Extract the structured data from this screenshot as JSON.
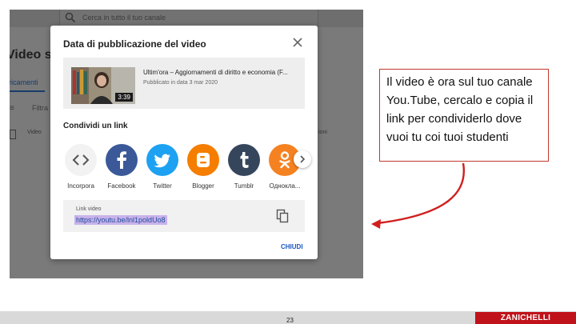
{
  "background": {
    "search_placeholder": "Cerca in tutto il tuo canale",
    "page_title": "Video su",
    "tab_label": "aricamenti",
    "filter_label": "Filtra",
    "column_video": "Video",
    "column_right": "ioni"
  },
  "modal": {
    "title": "Data di pubblicazione del video",
    "video": {
      "title": "Ultim'ora – Aggiornamenti di diritto e economia (F...",
      "published": "Pubblicato in data 3 mar 2020",
      "duration": "3:39"
    },
    "share_title": "Condividi un link",
    "share_options": [
      {
        "label": "Incorpora",
        "icon": "embed-icon",
        "color": "#f2f2f2"
      },
      {
        "label": "Facebook",
        "icon": "facebook-icon",
        "color": "#3b5998"
      },
      {
        "label": "Twitter",
        "icon": "twitter-icon",
        "color": "#1da1f2"
      },
      {
        "label": "Blogger",
        "icon": "blogger-icon",
        "color": "#f57d00"
      },
      {
        "label": "Tumblr",
        "icon": "tumblr-icon",
        "color": "#35465c"
      },
      {
        "label": "Одноклa...",
        "icon": "odnoklassniki-icon",
        "color": "#f58220"
      }
    ],
    "link_label": "Link video",
    "link_url": "https://youtu.be/lnl1poldUo8",
    "close_label": "CHIUDI"
  },
  "annotation": {
    "text": "Il video è ora sul tuo canale You.Tube, cercalo e copia il link per condividerlo dove vuoi tu coi tuoi studenti"
  },
  "footer": {
    "page_number": "23",
    "brand": "ZANICHELLI"
  }
}
